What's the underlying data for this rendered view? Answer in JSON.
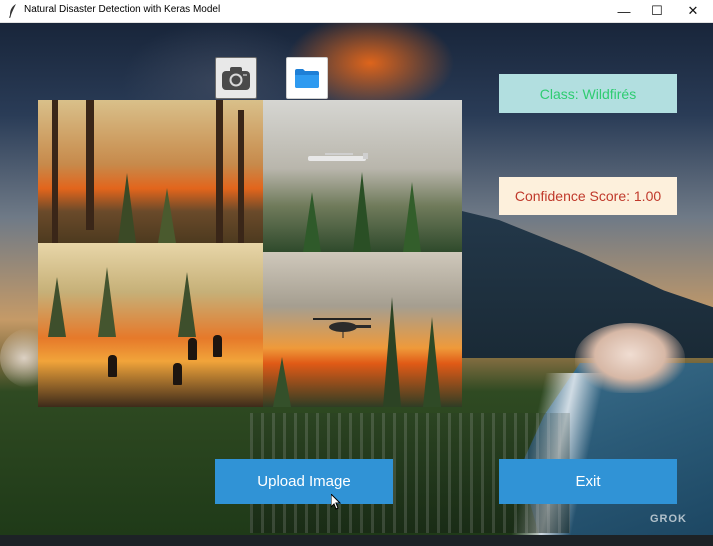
{
  "window": {
    "title": "Natural Disaster Detection with Keras Model",
    "controls": {
      "minimize": "—",
      "maximize": "☐",
      "close": "✕"
    }
  },
  "toolbar": {
    "camera_icon": "camera-icon",
    "folder_icon": "folder-icon"
  },
  "collage": {
    "panels": [
      "burning-forest",
      "water-bomber-plane",
      "firefighters-on-fire-line",
      "firefighting-helicopter"
    ]
  },
  "results": {
    "class_label": "Class: Wildfirés",
    "confidence_label": "Confidence Score: 1.00"
  },
  "buttons": {
    "upload_label": "Upload Image",
    "exit_label": "Exit"
  },
  "background": {
    "watermark": "GROK"
  },
  "colors": {
    "button_blue": "#3093d6",
    "class_text": "#2ecc71",
    "class_box": "#b2dfe0",
    "confidence_text": "#c0392b",
    "confidence_box": "#fdf0dc"
  }
}
